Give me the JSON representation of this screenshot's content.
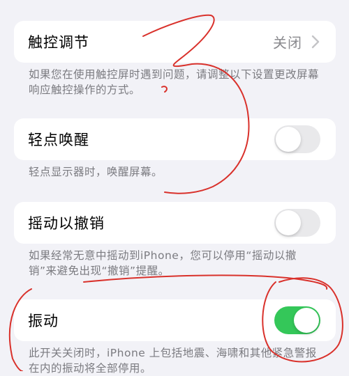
{
  "rows": [
    {
      "label": "触控调节",
      "value": "关闭"
    },
    {
      "label": "轻点唤醒",
      "toggle_on": false
    },
    {
      "label": "摇动以撤销",
      "toggle_on": false
    },
    {
      "label": "振动",
      "toggle_on": true
    }
  ],
  "notes": {
    "touch_accommodations": "如果您在使用触控屏时遇到问题，请调整以下设置更改屏幕响应触控操作的方式。",
    "tap_to_wake": "轻点显示器时，唤醒屏幕。",
    "shake_to_undo": "如果经常无意中摇动到iPhone，您可以停用“摇动以撤销”来避免出现“撤销”提醒。",
    "vibration": "此开关关闭时，iPhone 上包括地震、海啸和其他紧急警报在内的振动将全部停用。"
  },
  "colors": {
    "toggle_on": "#34c759",
    "toggle_off": "#e9e9eb",
    "annotation": "#d9312b"
  }
}
